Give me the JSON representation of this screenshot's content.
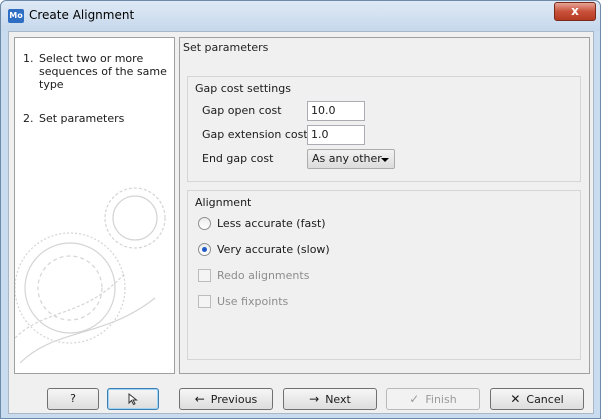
{
  "window": {
    "title": "Create Alignment",
    "app_icon": "Mo",
    "close_glyph": "x"
  },
  "steps": [
    {
      "num": "1.",
      "label": "Select two or more sequences of the same type"
    },
    {
      "num": "2.",
      "label": "Set parameters"
    }
  ],
  "main": {
    "heading": "Set parameters",
    "gap": {
      "title": "Gap cost settings",
      "open_label": "Gap open cost",
      "open_value": "10.0",
      "ext_label": "Gap extension cost",
      "ext_value": "1.0",
      "end_label": "End gap cost",
      "end_value": "As any other"
    },
    "alignment": {
      "title": "Alignment",
      "less": "Less accurate (fast)",
      "very": "Very accurate (slow)",
      "redo": "Redo alignments",
      "fix": "Use fixpoints"
    }
  },
  "footer": {
    "help": "?",
    "previous": "Previous",
    "next": "Next",
    "finish": "Finish",
    "cancel": "Cancel"
  },
  "icons": {
    "prev": "left-arrow-icon",
    "next": "right-arrow-icon",
    "finish": "checkmark-icon",
    "cancel": "x-icon",
    "reset": "reset-cursor-icon"
  }
}
